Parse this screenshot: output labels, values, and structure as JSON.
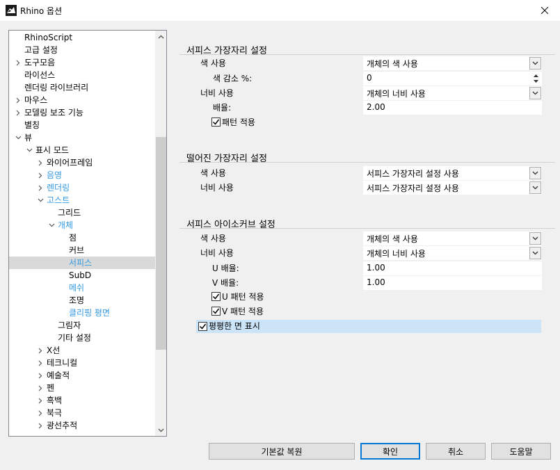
{
  "window": {
    "title": "Rhino 옵션"
  },
  "tree": {
    "items": [
      {
        "label": "RhinoScript",
        "depth": 0,
        "chevron": "none",
        "blue": false
      },
      {
        "label": "고급 설정",
        "depth": 0,
        "chevron": "none",
        "blue": false
      },
      {
        "label": "도구모음",
        "depth": 0,
        "chevron": "right",
        "blue": false
      },
      {
        "label": "라이선스",
        "depth": 0,
        "chevron": "none",
        "blue": false
      },
      {
        "label": "렌더링 라이브러리",
        "depth": 0,
        "chevron": "none",
        "blue": false
      },
      {
        "label": "마우스",
        "depth": 0,
        "chevron": "right",
        "blue": false
      },
      {
        "label": "모델링 보조 기능",
        "depth": 0,
        "chevron": "right",
        "blue": false
      },
      {
        "label": "별칭",
        "depth": 0,
        "chevron": "none",
        "blue": false
      },
      {
        "label": "뷰",
        "depth": 0,
        "chevron": "down",
        "blue": false
      },
      {
        "label": "표시 모드",
        "depth": 1,
        "chevron": "down",
        "blue": false
      },
      {
        "label": "와이어프레임",
        "depth": 2,
        "chevron": "right",
        "blue": false
      },
      {
        "label": "음영",
        "depth": 2,
        "chevron": "right",
        "blue": true
      },
      {
        "label": "렌더링",
        "depth": 2,
        "chevron": "right",
        "blue": true
      },
      {
        "label": "고스트",
        "depth": 2,
        "chevron": "down",
        "blue": true
      },
      {
        "label": "그리드",
        "depth": 3,
        "chevron": "none",
        "blue": false
      },
      {
        "label": "개체",
        "depth": 3,
        "chevron": "down",
        "blue": true
      },
      {
        "label": "점",
        "depth": 4,
        "chevron": "none",
        "blue": false
      },
      {
        "label": "커브",
        "depth": 4,
        "chevron": "none",
        "blue": false
      },
      {
        "label": "서피스",
        "depth": 4,
        "chevron": "none",
        "blue": true,
        "selected": true
      },
      {
        "label": "SubD",
        "depth": 4,
        "chevron": "none",
        "blue": false
      },
      {
        "label": "메쉬",
        "depth": 4,
        "chevron": "none",
        "blue": true
      },
      {
        "label": "조명",
        "depth": 4,
        "chevron": "none",
        "blue": false
      },
      {
        "label": "클리핑 평면",
        "depth": 4,
        "chevron": "none",
        "blue": true
      },
      {
        "label": "그림자",
        "depth": 3,
        "chevron": "none",
        "blue": false
      },
      {
        "label": "기타 설정",
        "depth": 3,
        "chevron": "none",
        "blue": false
      },
      {
        "label": "X선",
        "depth": 2,
        "chevron": "right",
        "blue": false
      },
      {
        "label": "테크니컬",
        "depth": 2,
        "chevron": "right",
        "blue": false
      },
      {
        "label": "예술적",
        "depth": 2,
        "chevron": "right",
        "blue": false
      },
      {
        "label": "펜",
        "depth": 2,
        "chevron": "right",
        "blue": false
      },
      {
        "label": "흑백",
        "depth": 2,
        "chevron": "right",
        "blue": false
      },
      {
        "label": "북극",
        "depth": 2,
        "chevron": "right",
        "blue": false
      },
      {
        "label": "광선추적",
        "depth": 2,
        "chevron": "right",
        "blue": false
      }
    ]
  },
  "surface_edge": {
    "title": "서피스 가장자리 설정",
    "color_label": "색 사용",
    "color_value": "개체의 색 사용",
    "reduction_label": "색 감소 %:",
    "reduction_value": "0",
    "width_label": "너비 사용",
    "width_value": "개체의 너비 사용",
    "scale_label": "배율:",
    "scale_value": "2.00",
    "pattern_label": "패턴 적용",
    "pattern_checked": true
  },
  "naked_edge": {
    "title": "떨어진 가장자리 설정",
    "color_label": "색 사용",
    "color_value": "서피스 가장자리 설정 사용",
    "width_label": "너비 사용",
    "width_value": "서피스 가장자리 설정 사용"
  },
  "isocurve": {
    "title": "서피스 아이소커브 설정",
    "color_label": "색 사용",
    "color_value": "개체의 색 사용",
    "width_label": "너비 사용",
    "width_value": "개체의 너비 사용",
    "u_scale_label": "U 배율:",
    "u_scale_value": "1.00",
    "v_scale_label": "V 배율:",
    "v_scale_value": "1.00",
    "u_pattern_label": "U 패턴 적용",
    "u_pattern_checked": true,
    "v_pattern_label": "V 패턴 적용",
    "v_pattern_checked": true
  },
  "flat_faces": {
    "label": "평평한 면 표시",
    "checked": true
  },
  "buttons": {
    "restore_defaults": "기본값 복원",
    "ok": "확인",
    "cancel": "취소",
    "help": "도움말"
  },
  "colors": {
    "selected_blue": "#3399e0",
    "highlight": "#cce4f7",
    "accent": "#0078d7"
  }
}
